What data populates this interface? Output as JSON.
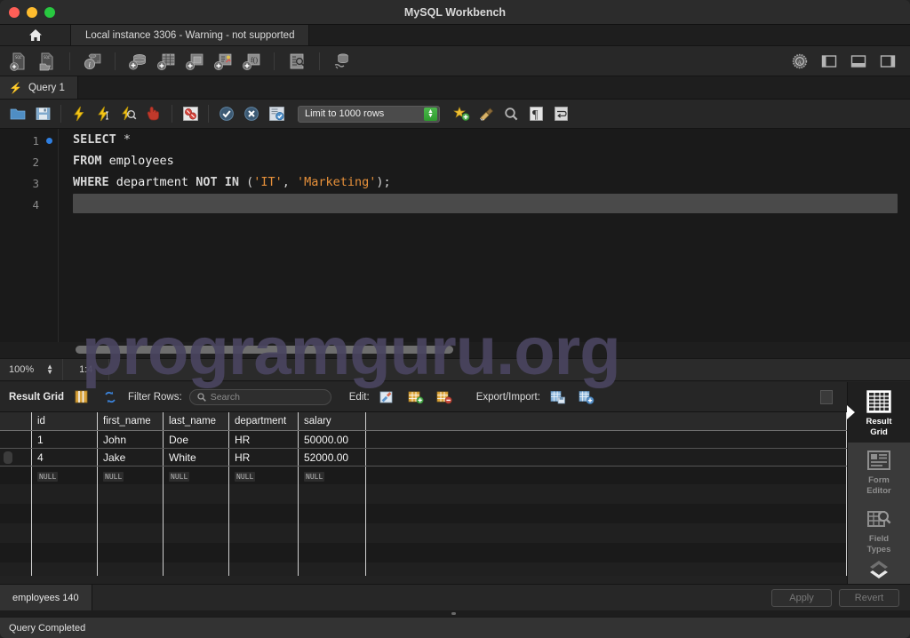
{
  "window": {
    "title": "MySQL Workbench",
    "traffic_lights": [
      "close",
      "minimize",
      "maximize"
    ]
  },
  "connection_strip": {
    "home_icon": "home-icon",
    "tab_label": "Local instance 3306 - Warning - not supported"
  },
  "main_toolbar": {
    "left_icons": [
      "new-sql-file-icon",
      "open-sql-file-icon"
    ],
    "info_icons": [
      "connection-info-icon"
    ],
    "object_icons": [
      "new-schema-icon",
      "new-table-icon",
      "new-view-icon",
      "new-procedure-icon",
      "new-function-icon"
    ],
    "search_icons": [
      "search-data-icon"
    ],
    "reconnect_icons": [
      "reconnect-server-icon"
    ],
    "right_icons": [
      "admin-toggle-icon",
      "toggle-sidebar-icon",
      "toggle-output-icon",
      "toggle-secondary-sidebar-icon"
    ]
  },
  "query_tab": {
    "icon": "lightning-icon",
    "label": "Query 1"
  },
  "editor_toolbar": {
    "icons": [
      "open-script-icon",
      "save-script-icon",
      "execute-icon",
      "execute-current-statement-icon",
      "explain-icon",
      "stop-execution-icon",
      "toggle-breakpoint-icon",
      "commit-icon",
      "rollback-icon",
      "autocommit-icon"
    ],
    "limit_label": "Limit to 1000 rows",
    "right_icons": [
      "beautify-icon",
      "clear-icon",
      "find-icon",
      "invisible-chars-icon",
      "wrap-lines-icon"
    ]
  },
  "editor": {
    "lines": [
      {
        "number": "1",
        "marker": true,
        "tokens": [
          {
            "t": "SELECT",
            "c": "kw"
          },
          {
            "t": " ",
            "c": "pln"
          },
          {
            "t": "*",
            "c": "pun"
          }
        ]
      },
      {
        "number": "2",
        "marker": false,
        "tokens": [
          {
            "t": "FROM",
            "c": "kw"
          },
          {
            "t": " employees",
            "c": "pln"
          }
        ]
      },
      {
        "number": "3",
        "marker": false,
        "tokens": [
          {
            "t": "WHERE",
            "c": "kw"
          },
          {
            "t": " department ",
            "c": "pln"
          },
          {
            "t": "NOT IN",
            "c": "kw"
          },
          {
            "t": " (",
            "c": "pun"
          },
          {
            "t": "'IT'",
            "c": "str"
          },
          {
            "t": ", ",
            "c": "pun"
          },
          {
            "t": "'Marketing'",
            "c": "str"
          },
          {
            "t": ");",
            "c": "pun"
          }
        ]
      },
      {
        "number": "4",
        "marker": false,
        "tokens": []
      }
    ],
    "status": {
      "zoom": "100%",
      "position": "1:4"
    }
  },
  "results_toolbar": {
    "title": "Result Grid",
    "grid_icon": "result-grid-icon",
    "refresh_icon": "refresh-icon",
    "filter_label": "Filter Rows:",
    "filter_placeholder": "Search",
    "search_icon": "search-icon",
    "edit_label": "Edit:",
    "edit_icons": [
      "edit-cell-icon",
      "insert-row-icon",
      "delete-row-icon"
    ],
    "export_label": "Export/Import:",
    "export_icons": [
      "export-recordset-icon",
      "import-recordset-icon"
    ],
    "wrap_cell_icon": "wrap-cell-content-icon"
  },
  "grid": {
    "columns": [
      "id",
      "first_name",
      "last_name",
      "department",
      "salary"
    ],
    "rows": [
      [
        "1",
        "John",
        "Doe",
        "HR",
        "50000.00"
      ],
      [
        "4",
        "Jake",
        "White",
        "HR",
        "52000.00"
      ]
    ],
    "null_label": "NULL",
    "null_row_count": 1,
    "blank_row_count": 5
  },
  "sidebar": {
    "items": [
      {
        "label_line1": "Result",
        "label_line2": "Grid",
        "icon": "result-grid-panel-icon",
        "active": true
      },
      {
        "label_line1": "Form",
        "label_line2": "Editor",
        "icon": "form-editor-icon",
        "active": false
      },
      {
        "label_line1": "Field",
        "label_line2": "Types",
        "icon": "field-types-icon",
        "active": false
      }
    ],
    "chevron_up_icon": "chevron-up-icon",
    "chevron_down_icon": "chevron-down-icon"
  },
  "bottom": {
    "tab_label": "employees 140",
    "apply_label": "Apply",
    "revert_label": "Revert"
  },
  "status_bar": {
    "message": "Query Completed"
  },
  "watermark": {
    "text": "programguru.org"
  },
  "colors": {
    "accent_blue": "#2f7fe0",
    "string_orange": "#e8913a",
    "keyword": "#d6d6d6",
    "watermark": "#4a4560",
    "window_bg": "#232323"
  }
}
